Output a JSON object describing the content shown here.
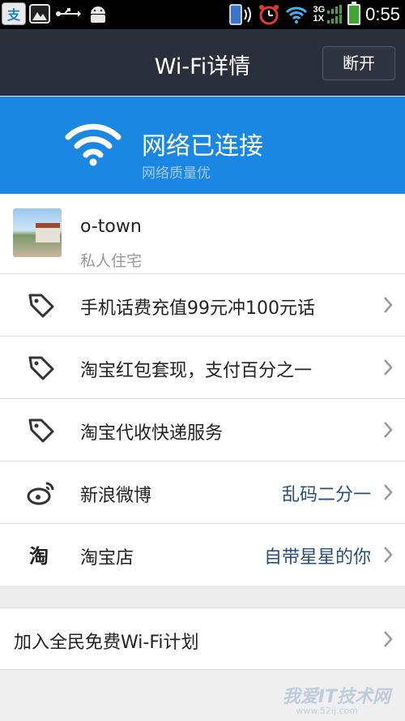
{
  "status_bar": {
    "alipay_glyph": "支",
    "network_3g": "3G",
    "network_1x": "1X",
    "time": "0:55"
  },
  "header": {
    "title": "Wi-Fi详情",
    "disconnect_label": "断开"
  },
  "banner": {
    "status": "网络已连接",
    "quality": "网络质量优",
    "color": "#1a88e3"
  },
  "network": {
    "name": "o-town",
    "type": "私人住宅"
  },
  "items": [
    {
      "icon": "tag-icon",
      "label": "手机话费充值99元冲100元话",
      "value": ""
    },
    {
      "icon": "tag-icon",
      "label": "淘宝红包套现，支付百分之一",
      "value": ""
    },
    {
      "icon": "tag-icon",
      "label": "淘宝代收快递服务",
      "value": ""
    },
    {
      "icon": "weibo-icon",
      "label": "新浪微博",
      "value": "乱码二分一"
    },
    {
      "icon": "taobao-icon",
      "label": "淘宝店",
      "value": "自带星星的你",
      "icon_glyph": "淘"
    }
  ],
  "join": {
    "label": "加入全民免费Wi-Fi计划"
  },
  "watermark": {
    "text": "我爱IT技术网",
    "sub": "www.52ij.com"
  }
}
